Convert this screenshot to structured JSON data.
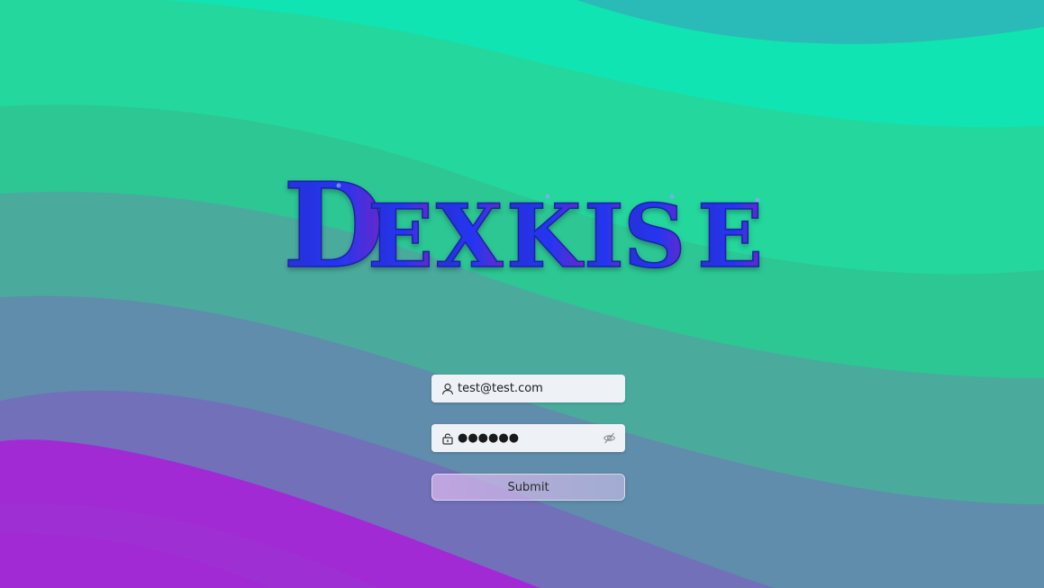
{
  "logo": {
    "text": "Dexkise",
    "letters": [
      "D",
      "E",
      "X",
      "K",
      "I",
      "S",
      "E"
    ]
  },
  "login": {
    "email": {
      "value": "test@test.com",
      "icon": "user-icon"
    },
    "password": {
      "masked_value": "●●●●●●",
      "icon": "lock-icon",
      "toggle_icon": "eye-off-icon"
    },
    "submit_label": "Submit"
  },
  "colors": {
    "top_teal": "#0fe3b0",
    "mid_teal": "#2ccb95",
    "slate": "#5f8fa8",
    "lavender": "#7470b8",
    "bottom_purple": "#a524d6",
    "logo_blue": "#2634e6",
    "logo_purple": "#6a28c8"
  }
}
